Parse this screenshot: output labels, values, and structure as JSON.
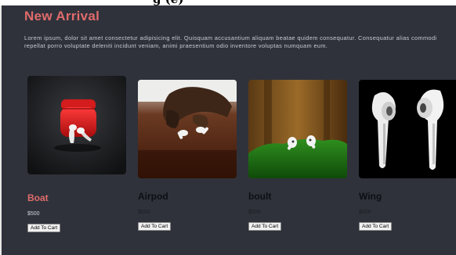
{
  "header_strip": {
    "text": "g (e)"
  },
  "section": {
    "title": "New Arrival",
    "description": "Lorem ipsum, dolor sit amet consectetur adipisicing elit. Quisquam accusantium aliquam beatae quidem consequatur. Consequatur alias commodi repellat porro voluptate deleniti incidunt veniam, animi praesentium odio inventore voluptas numquam eum."
  },
  "products": [
    {
      "name": "Boat",
      "price": "$500",
      "button_label": "Add To Cart",
      "image": "red-earbuds-case-icon",
      "highlighted": true
    },
    {
      "name": "Airpod",
      "price": "$500",
      "button_label": "Add To Cart",
      "image": "hand-holding-earbuds-icon",
      "highlighted": false
    },
    {
      "name": "boult",
      "price": "$500",
      "button_label": "Add To Cart",
      "image": "earbuds-on-moss-icon",
      "highlighted": false
    },
    {
      "name": "Wing",
      "price": "$500",
      "button_label": "Add To Cart",
      "image": "white-earbuds-icon",
      "highlighted": false
    }
  ],
  "colors": {
    "background": "#2f323b",
    "accent": "#e06b6b"
  }
}
